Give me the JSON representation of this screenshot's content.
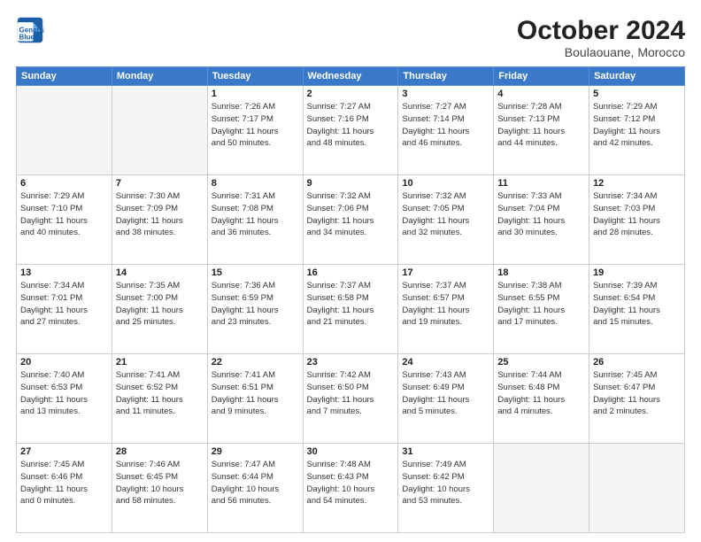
{
  "header": {
    "logo_line1": "General",
    "logo_line2": "Blue",
    "month": "October 2024",
    "location": "Boulaouane, Morocco"
  },
  "weekdays": [
    "Sunday",
    "Monday",
    "Tuesday",
    "Wednesday",
    "Thursday",
    "Friday",
    "Saturday"
  ],
  "weeks": [
    [
      {
        "day": "",
        "info": ""
      },
      {
        "day": "",
        "info": ""
      },
      {
        "day": "1",
        "info": "Sunrise: 7:26 AM\nSunset: 7:17 PM\nDaylight: 11 hours\nand 50 minutes."
      },
      {
        "day": "2",
        "info": "Sunrise: 7:27 AM\nSunset: 7:16 PM\nDaylight: 11 hours\nand 48 minutes."
      },
      {
        "day": "3",
        "info": "Sunrise: 7:27 AM\nSunset: 7:14 PM\nDaylight: 11 hours\nand 46 minutes."
      },
      {
        "day": "4",
        "info": "Sunrise: 7:28 AM\nSunset: 7:13 PM\nDaylight: 11 hours\nand 44 minutes."
      },
      {
        "day": "5",
        "info": "Sunrise: 7:29 AM\nSunset: 7:12 PM\nDaylight: 11 hours\nand 42 minutes."
      }
    ],
    [
      {
        "day": "6",
        "info": "Sunrise: 7:29 AM\nSunset: 7:10 PM\nDaylight: 11 hours\nand 40 minutes."
      },
      {
        "day": "7",
        "info": "Sunrise: 7:30 AM\nSunset: 7:09 PM\nDaylight: 11 hours\nand 38 minutes."
      },
      {
        "day": "8",
        "info": "Sunrise: 7:31 AM\nSunset: 7:08 PM\nDaylight: 11 hours\nand 36 minutes."
      },
      {
        "day": "9",
        "info": "Sunrise: 7:32 AM\nSunset: 7:06 PM\nDaylight: 11 hours\nand 34 minutes."
      },
      {
        "day": "10",
        "info": "Sunrise: 7:32 AM\nSunset: 7:05 PM\nDaylight: 11 hours\nand 32 minutes."
      },
      {
        "day": "11",
        "info": "Sunrise: 7:33 AM\nSunset: 7:04 PM\nDaylight: 11 hours\nand 30 minutes."
      },
      {
        "day": "12",
        "info": "Sunrise: 7:34 AM\nSunset: 7:03 PM\nDaylight: 11 hours\nand 28 minutes."
      }
    ],
    [
      {
        "day": "13",
        "info": "Sunrise: 7:34 AM\nSunset: 7:01 PM\nDaylight: 11 hours\nand 27 minutes."
      },
      {
        "day": "14",
        "info": "Sunrise: 7:35 AM\nSunset: 7:00 PM\nDaylight: 11 hours\nand 25 minutes."
      },
      {
        "day": "15",
        "info": "Sunrise: 7:36 AM\nSunset: 6:59 PM\nDaylight: 11 hours\nand 23 minutes."
      },
      {
        "day": "16",
        "info": "Sunrise: 7:37 AM\nSunset: 6:58 PM\nDaylight: 11 hours\nand 21 minutes."
      },
      {
        "day": "17",
        "info": "Sunrise: 7:37 AM\nSunset: 6:57 PM\nDaylight: 11 hours\nand 19 minutes."
      },
      {
        "day": "18",
        "info": "Sunrise: 7:38 AM\nSunset: 6:55 PM\nDaylight: 11 hours\nand 17 minutes."
      },
      {
        "day": "19",
        "info": "Sunrise: 7:39 AM\nSunset: 6:54 PM\nDaylight: 11 hours\nand 15 minutes."
      }
    ],
    [
      {
        "day": "20",
        "info": "Sunrise: 7:40 AM\nSunset: 6:53 PM\nDaylight: 11 hours\nand 13 minutes."
      },
      {
        "day": "21",
        "info": "Sunrise: 7:41 AM\nSunset: 6:52 PM\nDaylight: 11 hours\nand 11 minutes."
      },
      {
        "day": "22",
        "info": "Sunrise: 7:41 AM\nSunset: 6:51 PM\nDaylight: 11 hours\nand 9 minutes."
      },
      {
        "day": "23",
        "info": "Sunrise: 7:42 AM\nSunset: 6:50 PM\nDaylight: 11 hours\nand 7 minutes."
      },
      {
        "day": "24",
        "info": "Sunrise: 7:43 AM\nSunset: 6:49 PM\nDaylight: 11 hours\nand 5 minutes."
      },
      {
        "day": "25",
        "info": "Sunrise: 7:44 AM\nSunset: 6:48 PM\nDaylight: 11 hours\nand 4 minutes."
      },
      {
        "day": "26",
        "info": "Sunrise: 7:45 AM\nSunset: 6:47 PM\nDaylight: 11 hours\nand 2 minutes."
      }
    ],
    [
      {
        "day": "27",
        "info": "Sunrise: 7:45 AM\nSunset: 6:46 PM\nDaylight: 11 hours\nand 0 minutes."
      },
      {
        "day": "28",
        "info": "Sunrise: 7:46 AM\nSunset: 6:45 PM\nDaylight: 10 hours\nand 58 minutes."
      },
      {
        "day": "29",
        "info": "Sunrise: 7:47 AM\nSunset: 6:44 PM\nDaylight: 10 hours\nand 56 minutes."
      },
      {
        "day": "30",
        "info": "Sunrise: 7:48 AM\nSunset: 6:43 PM\nDaylight: 10 hours\nand 54 minutes."
      },
      {
        "day": "31",
        "info": "Sunrise: 7:49 AM\nSunset: 6:42 PM\nDaylight: 10 hours\nand 53 minutes."
      },
      {
        "day": "",
        "info": ""
      },
      {
        "day": "",
        "info": ""
      }
    ]
  ]
}
